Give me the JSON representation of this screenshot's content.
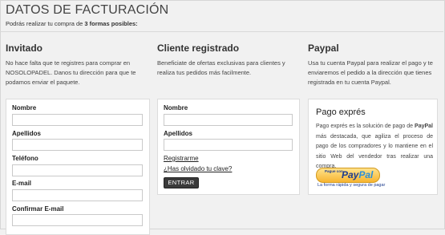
{
  "page": {
    "title": "DATOS DE FACTURACIÓN",
    "subtitle_prefix": "Podrás realizar tu compra de ",
    "subtitle_bold": "3 formas posibles:"
  },
  "invitado": {
    "title": "Invitado",
    "description": "No hace falta que te registres para comprar en NOSOLOPADEL. Danos tu dirección para que te podamos enviar el paquete.",
    "fields": [
      {
        "label": "Nombre",
        "value": ""
      },
      {
        "label": "Apellidos",
        "value": ""
      },
      {
        "label": "Teléfono",
        "value": ""
      },
      {
        "label": "E-mail",
        "value": ""
      },
      {
        "label": "Confirmar E-mail",
        "value": ""
      }
    ]
  },
  "registrado": {
    "title": "Cliente registrado",
    "description": "Beneficiate de ofertas exclusivas para clientes y realiza tus pedidos más facilmente.",
    "fields": [
      {
        "label": "Nombre",
        "value": ""
      },
      {
        "label": "Apellidos",
        "value": ""
      }
    ],
    "register_link": "Registrarme",
    "forgot_link": "¿Has olvidado tu clave?",
    "submit_label": "ENTRAR"
  },
  "paypal": {
    "title": "Paypal",
    "description": "Usa tu cuenta Paypal para realizar el pago y te enviaremos el pedido a la dirección que tienes registrada en tu cuenta Paypal.",
    "box_title": "Pago exprés",
    "box_text_prefix": "Pago exprés es la solución de pago de ",
    "box_text_bold": "PayPal",
    "box_text_suffix": " más destacada, que agiliza el proceso de pago de los compradores y lo mantiene en el sitio Web del vendedor tras realizar una compra.",
    "button_small": "Pague con",
    "button_logo_a": "Pay",
    "button_logo_b": "Pal",
    "button_caption": "La forma rápida y segura de pagar"
  }
}
